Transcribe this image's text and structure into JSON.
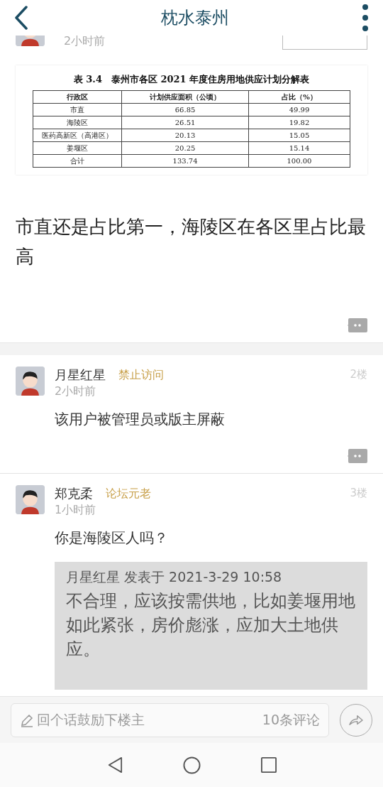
{
  "header": {
    "title": "枕水泰州"
  },
  "top_post": {
    "time": "2小时前",
    "table": {
      "title": "表 3.4　泰州市各区 2021 年度住房用地供应计划分解表",
      "columns": [
        "行政区",
        "计划供应面积（公顷）",
        "占比（%）"
      ],
      "rows": [
        [
          "市直",
          "66.85",
          "49.99"
        ],
        [
          "海陵区",
          "26.51",
          "19.82"
        ],
        [
          "医药高新区（高港区）",
          "20.13",
          "15.05"
        ],
        [
          "姜堰区",
          "20.25",
          "15.14"
        ],
        [
          "合计",
          "133.74",
          "100.00"
        ]
      ]
    },
    "text": "市直还是占比第一，海陵区在各区里占比最高"
  },
  "comments": [
    {
      "name": "月星红星",
      "badge": "禁止访问",
      "time": "2小时前",
      "floor": "2楼",
      "text": "该用户被管理员或版主屏蔽"
    },
    {
      "name": "郑克柔",
      "badge": "论坛元老",
      "time": "1小时前",
      "floor": "3楼",
      "text": "你是海陵区人吗？",
      "quote": {
        "header": "月星红星 发表于 2021-3-29 10:58",
        "text": "不合理，应该按需供地，比如姜堰用地如此紧张，房价彪涨，应加大土地供应。"
      }
    }
  ],
  "reply_bar": {
    "placeholder": "回个话鼓励下楼主",
    "count": "10条评论"
  }
}
